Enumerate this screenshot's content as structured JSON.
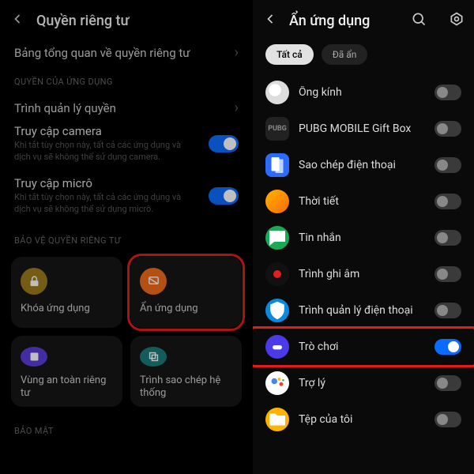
{
  "left": {
    "title": "Quyền riêng tư",
    "overview": "Bảng tổng quan về quyền riêng tư",
    "section_perm": "QUYỀN CỦA ỨNG DỤNG",
    "perm_mgr": "Trình quản lý quyền",
    "camera_title": "Truy cập camera",
    "camera_desc": "Khi tắt tùy chọn này, tất cả các ứng dụng và dịch vụ sẽ không thể sử dụng camera.",
    "mic_title": "Truy cập micrô",
    "mic_desc": "Khi tắt tùy chọn này, tất cả các ứng dụng và dịch vụ sẽ không thể sử dụng micrô.",
    "section_protect": "BẢO VỆ QUYỀN RIÊNG TƯ",
    "cards": {
      "lock": "Khóa ứng dụng",
      "hide": "Ẩn ứng dụng",
      "safe": "Vùng an toàn riêng tư",
      "clone": "Trình sao chép hệ thống"
    },
    "section_sec": "BẢO MẬT"
  },
  "right": {
    "title": "Ẩn ứng dụng",
    "tabs": {
      "all": "Tất cả",
      "hidden": "Đã ẩn"
    },
    "apps": [
      {
        "label": "Ống kính"
      },
      {
        "label": "PUBG MOBILE Gift Box"
      },
      {
        "label": "Sao chép điện thoại"
      },
      {
        "label": "Thời tiết"
      },
      {
        "label": "Tin nhắn"
      },
      {
        "label": "Trình ghi âm"
      },
      {
        "label": "Trình quản lý điện thoại"
      },
      {
        "label": "Trò chơi"
      },
      {
        "label": "Trợ lý"
      },
      {
        "label": "Tệp của tôi"
      }
    ]
  }
}
